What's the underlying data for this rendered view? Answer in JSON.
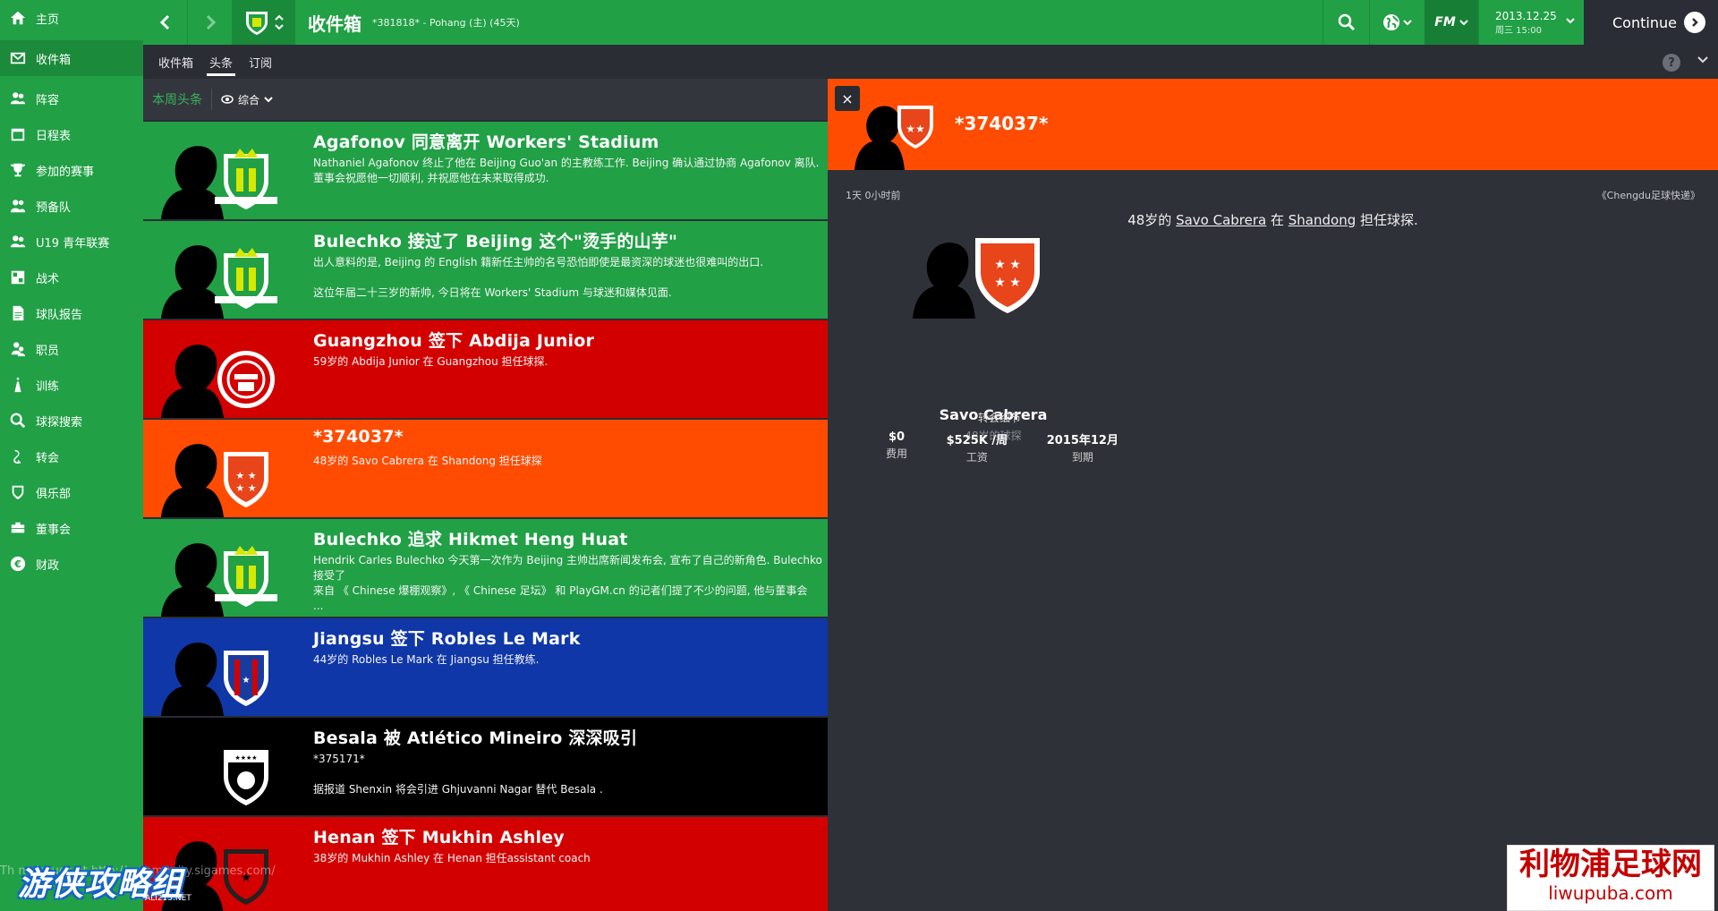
{
  "sidebar": {
    "items": [
      {
        "label": "主页",
        "icon": "home-icon"
      },
      {
        "label": "收件箱",
        "icon": "inbox-icon",
        "active": true
      },
      {
        "label": "阵容",
        "icon": "squad-icon"
      },
      {
        "label": "日程表",
        "icon": "schedule-icon"
      },
      {
        "label": "参加的赛事",
        "icon": "trophy-icon"
      },
      {
        "label": "预备队",
        "icon": "reserves-icon"
      },
      {
        "label": "U19 青年联赛",
        "icon": "youth-icon"
      },
      {
        "label": "战术",
        "icon": "tactics-icon"
      },
      {
        "label": "球队报告",
        "icon": "report-icon"
      },
      {
        "label": "职员",
        "icon": "staff-icon"
      },
      {
        "label": "训练",
        "icon": "training-icon"
      },
      {
        "label": "球探搜索",
        "icon": "search-icon"
      },
      {
        "label": "转会",
        "icon": "transfer-icon"
      },
      {
        "label": "俱乐部",
        "icon": "club-icon"
      },
      {
        "label": "董事会",
        "icon": "board-icon"
      },
      {
        "label": "财政",
        "icon": "finance-icon"
      }
    ]
  },
  "topbar": {
    "title": "收件箱",
    "subtitle": "*381818* - Pohang (主) (45天)",
    "fm_label": "FM",
    "date": "2013.12.25",
    "weekday_time": "周三 15:00",
    "continue_label": "Continue"
  },
  "subtabs": [
    {
      "label": "收件箱"
    },
    {
      "label": "头条",
      "active": true
    },
    {
      "label": "订阅"
    }
  ],
  "help_label": "?",
  "filter": {
    "label": "本周头条",
    "view_label": "综合"
  },
  "news": [
    {
      "headline": "Agafonov 同意离开 Workers' Stadium",
      "body": "Nathaniel Agafonov 终止了他在 Beijing Guo'an 的主教练工作. Beijing 确认通过协商 Agafonov 离队.\n董事会祝愿他一切顺利, 并祝愿他在未来取得成功.",
      "bg": "#21a046",
      "crest": "green"
    },
    {
      "headline": "Bulechko 接过了 Beijing 这个\"烫手的山芋\"",
      "body": "出人意料的是, Beijing 的 English 籍新任主帅的名号恐怕即使是最资深的球迷也很难叫的出口.\n\n这位年届二十三岁的新帅, 今日将在 Workers' Stadium 与球迷和媒体见面.",
      "bg": "#21a046",
      "crest": "green"
    },
    {
      "headline": "Guangzhou 签下 Abdija Junior",
      "body": "59岁的 Abdija Junior 在 Guangzhou 担任球探.",
      "bg": "#d30000",
      "crest": "red"
    },
    {
      "headline": "*374037*",
      "body": "48岁的 Savo Cabrera 在 Shandong 担任球探",
      "bg": "#ff4c00",
      "crest": "orange"
    },
    {
      "headline": "Bulechko 追求 Hikmet Heng Huat",
      "body": "Hendrik Carles Bulechko 今天第一次作为 Beijing 主帅出席新闻发布会, 宣布了自己的新角色. Bulechko 接受了\n来自 《 Chinese 爆棚观察》, 《 Chinese 足坛》 和 PlayGM.cn 的记者们提了不少的问题, 他与董事会\n...",
      "bg": "#21a046",
      "crest": "green"
    },
    {
      "headline": "Jiangsu 签下 Robles Le Mark",
      "body": "44岁的 Robles Le Mark 在 Jiangsu 担任教练.",
      "bg": "#0f37a8",
      "crest": "blue"
    },
    {
      "headline": "Besala 被 Atlético Mineiro 深深吸引",
      "body": "*375171*\n\n据报道 Shenxin 将会引进 Ghjuvanni Nagar 替代 Besala .",
      "bg": "#000000",
      "crest": "black"
    },
    {
      "headline": "Henan 签下 Mukhin Ashley",
      "body": "38岁的 Mukhin Ashley 在 Henan 担任assistant coach",
      "bg": "#d30000",
      "crest": "red2"
    }
  ],
  "detail": {
    "close_label": "×",
    "title": "*374037*",
    "time": "1天 0小时前",
    "source": "《Chengdu足球快递》",
    "lead_pre": "48岁的 ",
    "lead_name": "Savo Cabrera",
    "lead_mid": " 在 ",
    "lead_club": "Shandong",
    "lead_post": " 担任球探.",
    "player_name": "Savo Cabrera",
    "player_role": "48岁的球探",
    "transfer_title": "转会细节",
    "transfer": [
      {
        "value": "$0",
        "key": "费用"
      },
      {
        "value": "$525K /周",
        "key": "工资"
      },
      {
        "value": "2015年12月",
        "key": "到期"
      }
    ]
  },
  "footer_text": "Th                   ny issues at http://community.sigames.com/",
  "watermarks": {
    "left_title": "游侠攻略组",
    "left_sub": "ALI213.NET",
    "right_title": "利物浦足球网",
    "right_sub": "liwupuba.com"
  },
  "colors": {
    "brand_green": "#21a046",
    "orange": "#ff4c00",
    "red": "#d30000",
    "blue": "#0f37a8"
  }
}
